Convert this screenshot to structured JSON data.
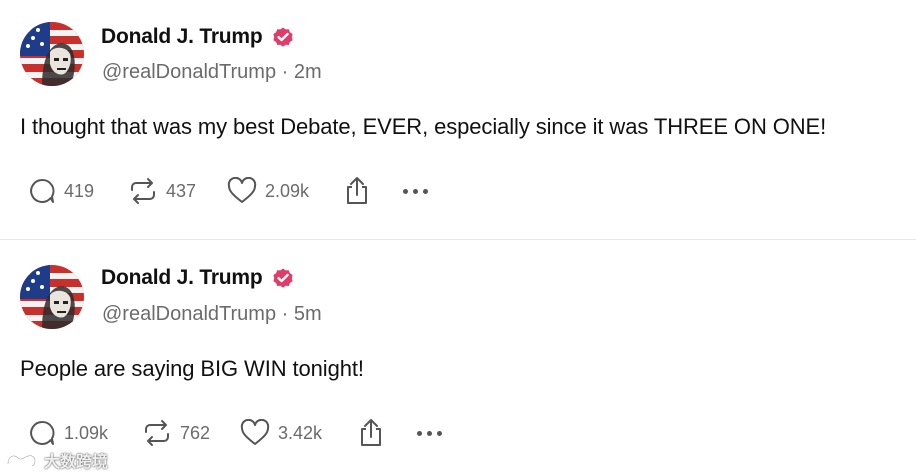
{
  "posts": [
    {
      "name": "Donald J. Trump",
      "handle": "@realDonaldTrump",
      "time": "2m",
      "text": "I thought that was my best Debate, EVER, especially since it was THREE ON ONE!",
      "replies": "419",
      "reposts": "437",
      "likes": "2.09k"
    },
    {
      "name": "Donald J. Trump",
      "handle": "@realDonaldTrump",
      "time": "5m",
      "text": "People are saying BIG WIN tonight!",
      "replies": "1.09k",
      "reposts": "762",
      "likes": "3.42k"
    }
  ],
  "icons": {
    "reply": "reply-icon",
    "repost": "repost-icon",
    "like": "heart-icon",
    "share": "share-icon",
    "more": "more-dots-icon",
    "verified": "verified-badge-icon"
  },
  "colors": {
    "verified_badge": "#e03c6a",
    "secondary_text": "#6b6b6b",
    "divider": "#e6e6e6"
  },
  "watermark": {
    "text": "大数跨境"
  }
}
